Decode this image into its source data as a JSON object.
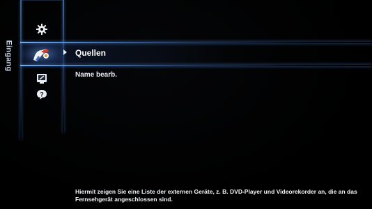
{
  "section": {
    "label": "Eingang"
  },
  "icons": [
    {
      "name": "gear-icon"
    },
    {
      "name": "input-source-icon"
    },
    {
      "name": "support-icon"
    },
    {
      "name": "help-icon"
    }
  ],
  "menu": {
    "items": [
      {
        "label": "Quellen",
        "selected": true
      },
      {
        "label": "Name bearb.",
        "selected": false
      }
    ]
  },
  "help": {
    "text": "Hiermit zeigen Sie eine Liste der externen Geräte, z. B. DVD-Player und Videorekorder an, die an das Fernsehgerät angeschlossen sind."
  },
  "colors": {
    "background": "#000000",
    "accent_glow": "#5a96e6",
    "text": "#ffffff"
  }
}
